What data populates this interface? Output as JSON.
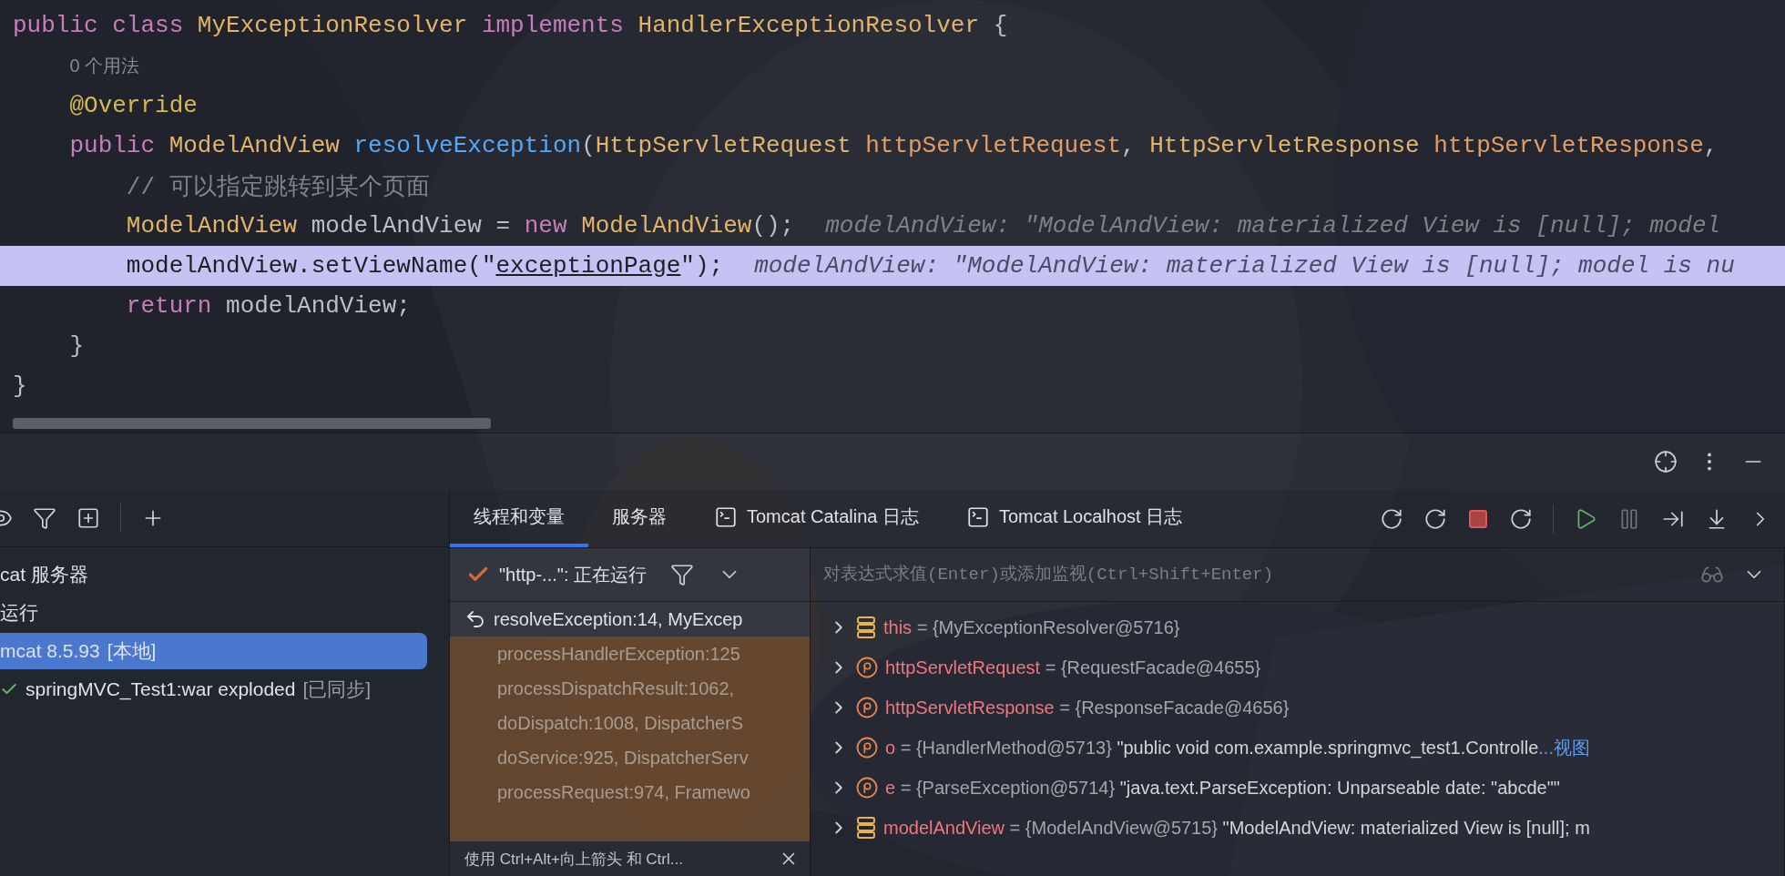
{
  "editor": {
    "lines": [
      {
        "kind": "code",
        "selected": false,
        "tokens": [
          {
            "kind": "keyword",
            "text": "public class "
          },
          {
            "kind": "type",
            "text": "MyExceptionResolver "
          },
          {
            "kind": "keyword",
            "text": "implements "
          },
          {
            "kind": "type",
            "text": "HandlerExceptionResolver "
          },
          {
            "kind": "plain",
            "text": "{"
          }
        ]
      },
      {
        "kind": "usages",
        "selected": false,
        "text": "    0 个用法"
      },
      {
        "kind": "code",
        "selected": false,
        "tokens": [
          {
            "kind": "annotation",
            "text": "    @Override"
          }
        ]
      },
      {
        "kind": "code",
        "selected": false,
        "tokens": [
          {
            "kind": "keyword",
            "text": "    public "
          },
          {
            "kind": "type",
            "text": "ModelAndView "
          },
          {
            "kind": "method",
            "text": "resolveException"
          },
          {
            "kind": "plain",
            "text": "("
          },
          {
            "kind": "type",
            "text": "HttpServletRequest "
          },
          {
            "kind": "param",
            "text": "httpServletRequest"
          },
          {
            "kind": "plain",
            "text": ", "
          },
          {
            "kind": "type",
            "text": "HttpServletResponse "
          },
          {
            "kind": "param",
            "text": "httpServletResponse"
          },
          {
            "kind": "plain",
            "text": ","
          }
        ]
      },
      {
        "kind": "code",
        "selected": false,
        "tokens": [
          {
            "kind": "comment",
            "text": "        // 可以指定跳转到某个页面"
          }
        ]
      },
      {
        "kind": "code",
        "selected": false,
        "tokens": [
          {
            "kind": "type",
            "text": "        ModelAndView "
          },
          {
            "kind": "plain",
            "text": "modelAndView = "
          },
          {
            "kind": "keyword",
            "text": "new "
          },
          {
            "kind": "type",
            "text": "ModelAndView"
          },
          {
            "kind": "plain",
            "text": "();"
          }
        ],
        "inline_value": "modelAndView: \"ModelAndView: materialized View is [null]; model"
      },
      {
        "kind": "code",
        "selected": true,
        "tokens": [
          {
            "kind": "plain",
            "text": "        modelAndView.setViewName(\""
          },
          {
            "kind": "link",
            "text": "exceptionPage"
          },
          {
            "kind": "plain",
            "text": "\");"
          }
        ],
        "inline_value": "modelAndView: \"ModelAndView: materialized View is [null]; model is nu"
      },
      {
        "kind": "code",
        "selected": false,
        "tokens": [
          {
            "kind": "keyword",
            "text": "        return "
          },
          {
            "kind": "plain",
            "text": "modelAndView;"
          }
        ]
      },
      {
        "kind": "code",
        "selected": false,
        "tokens": [
          {
            "kind": "plain",
            "text": "    }"
          }
        ]
      },
      {
        "kind": "code",
        "selected": false,
        "tokens": [
          {
            "kind": "plain",
            "text": "}"
          }
        ]
      }
    ]
  },
  "services_tree": [
    {
      "kind": "group",
      "label": "cat 服务器",
      "selected": false
    },
    {
      "kind": "group",
      "label": "运行",
      "selected": false
    },
    {
      "kind": "server",
      "label": "mcat 8.5.93",
      "suffix": "[本地]",
      "selected": true
    },
    {
      "kind": "artifact",
      "label": "springMVC_Test1:war exploded",
      "suffix": "[已同步]",
      "selected": false
    }
  ],
  "tabs": [
    {
      "kind": "plain",
      "label": "线程和变量",
      "selected": true
    },
    {
      "kind": "plain",
      "label": "服务器",
      "selected": false
    },
    {
      "kind": "console",
      "label": "Tomcat Catalina 日志",
      "selected": false
    },
    {
      "kind": "console",
      "label": "Tomcat Localhost 日志",
      "selected": false
    }
  ],
  "thread": {
    "label": "\"http-...\": 正在运行"
  },
  "frames": [
    {
      "text": "resolveException:14, MyExcep",
      "selected": true
    },
    {
      "text": "processHandlerException:125",
      "selected": false
    },
    {
      "text": "processDispatchResult:1062,",
      "selected": false
    },
    {
      "text": "doDispatch:1008, DispatcherS",
      "selected": false
    },
    {
      "text": "doService:925, DispatcherServ",
      "selected": false
    },
    {
      "text": "processRequest:974, Framewo",
      "selected": false
    }
  ],
  "frames_hint": "使用 Ctrl+Alt+向上箭头 和 Ctrl...",
  "evaluate": {
    "placeholder": "对表达式求值(Enter)或添加监视(Ctrl+Shift+Enter)"
  },
  "variables": [
    {
      "kind": "field",
      "name": "this",
      "value": "= {MyExceptionResolver@5716}"
    },
    {
      "kind": "parameter",
      "name": "httpServletRequest",
      "value": "= {RequestFacade@4655}"
    },
    {
      "kind": "parameter",
      "name": "httpServletResponse",
      "value": "= {ResponseFacade@4656}"
    },
    {
      "kind": "parameter",
      "name": "o",
      "value": "= {HandlerMethod@5713}",
      "detail": "\"public void com.example.springmvc_test1.Controlle",
      "link": "...视图"
    },
    {
      "kind": "parameter",
      "name": "e",
      "value": "= {ParseException@5714}",
      "detail": "\"java.text.ParseException: Unparseable date: \"abcde\"\""
    },
    {
      "kind": "field",
      "name": "modelAndView",
      "value": "= {ModelAndView@5715}",
      "detail": "\"ModelAndView: materialized View is [null]; m"
    }
  ]
}
